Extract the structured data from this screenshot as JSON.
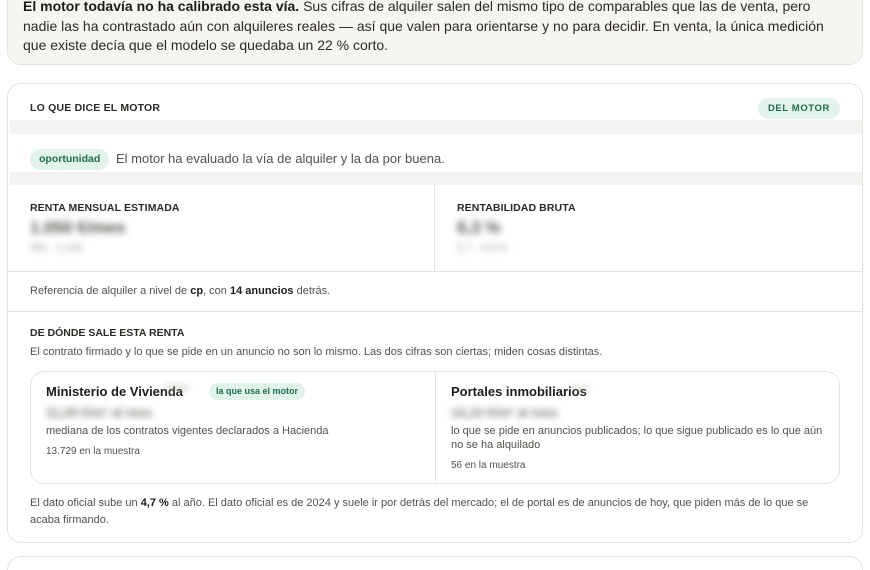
{
  "notice": {
    "lead": "El motor todavía no ha calibrado esta vía.",
    "body": " Sus cifras de alquiler salen del mismo tipo de comparables que las de venta, pero nadie las ha contrastado aún con alquileres reales — así que valen para orientarse y no para decidir. En venta, la única medición que existe decía que el modelo se quedaba un 22 % corto."
  },
  "card": {
    "title": "LO QUE DICE EL MOTOR",
    "badge": "DEL MOTOR",
    "verdict": {
      "label": "oportunidad",
      "text": "El motor ha evaluado la vía de alquiler y la da por buena."
    },
    "metrics": [
      {
        "label": "RENTA MENSUAL ESTIMADA",
        "value": "1.050 €/mes",
        "sub": "950 – 1.150"
      },
      {
        "label": "RENTABILIDAD BRUTA",
        "value": "6,3 %",
        "sub": "5,7 – 6,9 %"
      }
    ],
    "reference": {
      "prefix": "Referencia de alquiler a nivel de ",
      "level": "cp",
      "middle": ", con ",
      "count": "14 anuncios",
      "suffix": " detrás."
    },
    "sources_section": {
      "title": "DE DÓNDE SALE ESTA RENTA",
      "description": "El contrato firmado y lo que se pide en un anuncio no son lo mismo. Las dos cifras son ciertas; miden cosas distintas.",
      "sources": [
        {
          "name": "Ministerio de Vivienda",
          "tag": "2024",
          "badge": "la que usa el motor",
          "value": "11,20 €/m² al mes",
          "description": "mediana de los contratos vigentes declarados a Hacienda",
          "count": "13.729 en la muestra"
        },
        {
          "name": "Portales inmobiliarios",
          "tag": "hoy",
          "value": "14,10 €/m² al mes",
          "description": "lo que se pide en anuncios publicados; lo que sigue publicado es lo que aún no se ha alquilado",
          "count": "56 en la muestra"
        }
      ]
    },
    "footer": {
      "prefix": "El dato oficial sube un ",
      "growth": "4,7 %",
      "suffix": " al año. El dato oficial es de 2024 y suele ir por detrás del mercado; el de portal es de anuncios de hoy, que piden más de lo que se acaba firmando."
    }
  },
  "colors": {
    "accent_green": "#1f6e4a",
    "accent_green_bg": "#e2f3eb",
    "border": "#e6e3dc",
    "notice_bg": "#f6f5f2"
  }
}
